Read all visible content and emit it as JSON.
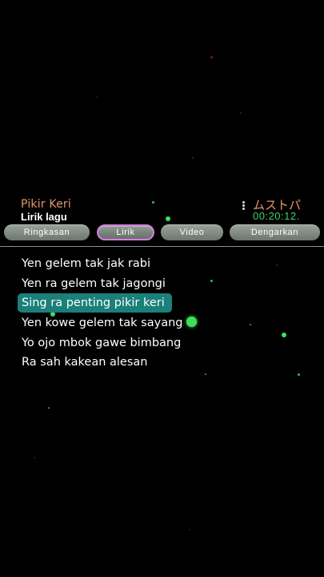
{
  "song": {
    "title": "Pikir Keri",
    "subtitle": "Lirik lagu"
  },
  "app": {
    "name": "ムストパ",
    "clock": "00:20:12."
  },
  "tabs": [
    {
      "label": "Ringkasan",
      "active": false
    },
    {
      "label": "Lirik",
      "active": true
    },
    {
      "label": "Video",
      "active": false
    },
    {
      "label": "Dengarkan",
      "active": false
    }
  ],
  "lyrics": [
    "Yen gelem tak jak rabi",
    "Yen ra gelem tak jagongi",
    "Sing ra penting pikir keri",
    "Yen kowe gelem tak sayang",
    "Yo ojo mbok gawe bimbang",
    "Ra sah kakean alesan"
  ],
  "current_line_index": 2,
  "colors": {
    "background": "#000000",
    "title": "#e8956a",
    "clock": "#3ccf66",
    "highlight": "#1b7f7a",
    "active_tab_border": "#d27de0",
    "particles": "#3ee05a"
  }
}
